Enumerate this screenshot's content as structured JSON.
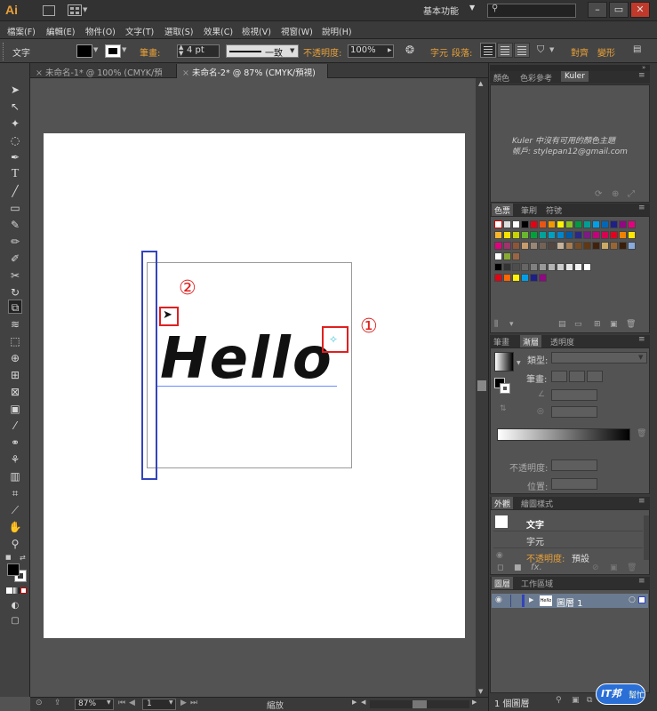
{
  "app": {
    "logo": "Ai",
    "workspace": "基本功能"
  },
  "window": {
    "minimize": "–",
    "restore": "▭",
    "close": "✕"
  },
  "menu": [
    "檔案(F)",
    "編輯(E)",
    "物件(O)",
    "文字(T)",
    "選取(S)",
    "效果(C)",
    "檢視(V)",
    "視窗(W)",
    "說明(H)"
  ],
  "control": {
    "mode": "文字",
    "stroke_label": "筆畫:",
    "stroke_value": "4 pt",
    "stroke_style": "一致",
    "opacity_label": "不透明度:",
    "opacity_value": "100%",
    "char_link": "字元",
    "para_link": "段落:",
    "align_link": "對齊",
    "transform_link": "變形"
  },
  "tabs": [
    "未命名-1* @ 100% (CMYK/預視)",
    "未命名-2* @ 87% (CMYK/預視)"
  ],
  "artwork": {
    "text": "Hello",
    "marker1": "①",
    "marker2": "②"
  },
  "status": {
    "zoom": "87%",
    "page": "1",
    "mode": "縮放"
  },
  "kuler": {
    "tabs": [
      "顏色",
      "色彩參考",
      "Kuler"
    ],
    "message": "Kuler 中沒有可用的顏色主題",
    "account": "帳戶: stylepan12@gmail.com"
  },
  "swatches": {
    "tabs": [
      "色票",
      "筆刷",
      "符號"
    ]
  },
  "stroke_panel": {
    "tabs": [
      "筆畫",
      "漸層",
      "透明度"
    ],
    "type_label": "類型:",
    "stroke_label": "筆畫:",
    "opacity_label": "不透明度:",
    "position_label": "位置:"
  },
  "appearance": {
    "tabs": [
      "外觀",
      "繪圖樣式"
    ],
    "row1": "文字",
    "row2": "字元",
    "opacity_label": "不透明度:",
    "opacity_value": "預設"
  },
  "layers": {
    "tabs": [
      "圖層",
      "工作區域"
    ],
    "layer_name": "圖層 1",
    "footer": "1 個圖層"
  },
  "watermark": {
    "name": "IT邦",
    "sub": "幫忙"
  },
  "colors": {
    "accent": "#e8a038",
    "selection_blue": "#3344bb",
    "marker_red": "#e02020",
    "baseline": "#6b8cff"
  }
}
